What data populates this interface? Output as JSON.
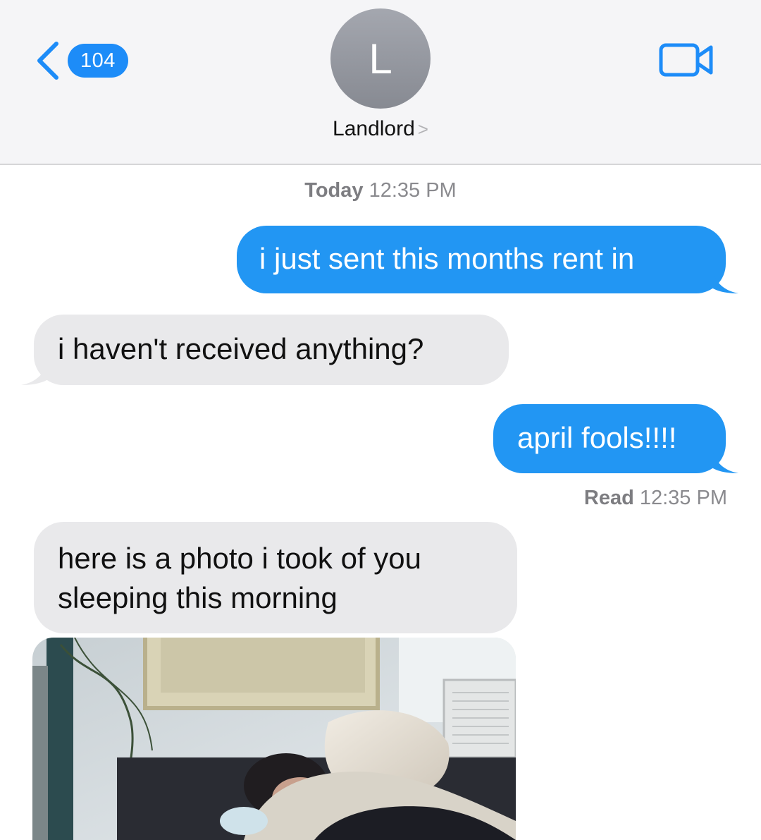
{
  "header": {
    "back_count": "104",
    "avatar_initial": "L",
    "contact_name": "Landlord",
    "chevron": ">"
  },
  "thread": {
    "timestamp_day": "Today",
    "timestamp_time": "12:35 PM",
    "messages": [
      {
        "direction": "outgoing",
        "text": "i just sent this months rent in"
      },
      {
        "direction": "incoming",
        "text": "i haven't received anything?"
      },
      {
        "direction": "outgoing",
        "text": "april fools!!!!"
      },
      {
        "direction": "incoming",
        "text": "here is a photo i took of you sleeping this morning"
      }
    ],
    "read_label": "Read",
    "read_time": "12:35 PM"
  },
  "colors": {
    "outgoing_bubble": "#2296f3",
    "incoming_bubble": "#e9e9eb",
    "accent": "#1d8cf8"
  },
  "icons": {
    "back": "chevron-left-icon",
    "video": "video-camera-icon"
  }
}
